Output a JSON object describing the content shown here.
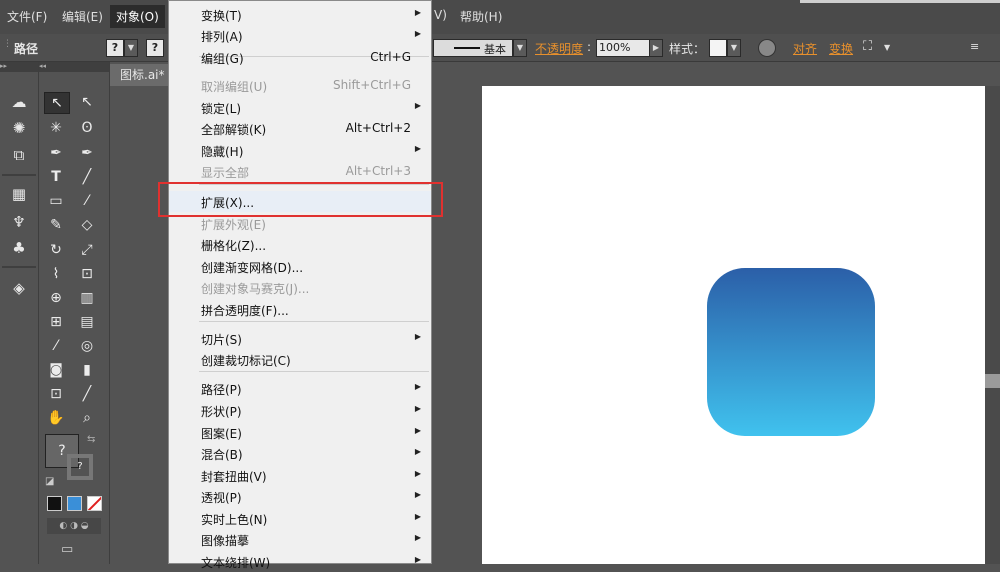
{
  "menubar": {
    "items": [
      "文件(F)",
      "编辑(E)",
      "对象(O)",
      "V)",
      "帮助(H)"
    ]
  },
  "controlbar": {
    "selection_label": "路径",
    "stroke_style": "基本",
    "opacity_label": "不透明度",
    "opacity_value": "100%",
    "style_label": "样式：",
    "align_label": "对齐",
    "transform_label": "变换",
    "unknown_glyph": "?"
  },
  "document": {
    "tab_title": "图标.ai*"
  },
  "tools": {
    "swatch_unknown": "?"
  },
  "object_menu": {
    "items": [
      {
        "label": "变换(T)",
        "shortcut": "",
        "submenu": true,
        "disabled": false
      },
      {
        "label": "排列(A)",
        "shortcut": "",
        "submenu": true,
        "disabled": false
      },
      {
        "label": "编组(G)",
        "shortcut": "Ctrl+G",
        "submenu": false,
        "disabled": false
      },
      {
        "label": "取消编组(U)",
        "shortcut": "Shift+Ctrl+G",
        "submenu": false,
        "disabled": true
      },
      {
        "label": "锁定(L)",
        "shortcut": "",
        "submenu": true,
        "disabled": false
      },
      {
        "label": "全部解锁(K)",
        "shortcut": "Alt+Ctrl+2",
        "submenu": false,
        "disabled": false
      },
      {
        "label": "隐藏(H)",
        "shortcut": "",
        "submenu": true,
        "disabled": false
      },
      {
        "label": "显示全部",
        "shortcut": "Alt+Ctrl+3",
        "submenu": false,
        "disabled": true
      },
      {
        "label": "扩展(X)...",
        "shortcut": "",
        "submenu": false,
        "disabled": false,
        "highlighted": true
      },
      {
        "label": "扩展外观(E)",
        "shortcut": "",
        "submenu": false,
        "disabled": true
      },
      {
        "label": "栅格化(Z)...",
        "shortcut": "",
        "submenu": false,
        "disabled": false
      },
      {
        "label": "创建渐变网格(D)...",
        "shortcut": "",
        "submenu": false,
        "disabled": false
      },
      {
        "label": "创建对象马赛克(J)...",
        "shortcut": "",
        "submenu": false,
        "disabled": true
      },
      {
        "label": "拼合透明度(F)...",
        "shortcut": "",
        "submenu": false,
        "disabled": false
      },
      {
        "label": "切片(S)",
        "shortcut": "",
        "submenu": true,
        "disabled": false
      },
      {
        "label": "创建裁切标记(C)",
        "shortcut": "",
        "submenu": false,
        "disabled": false
      },
      {
        "label": "路径(P)",
        "shortcut": "",
        "submenu": true,
        "disabled": false
      },
      {
        "label": "形状(P)",
        "shortcut": "",
        "submenu": true,
        "disabled": false
      },
      {
        "label": "图案(E)",
        "shortcut": "",
        "submenu": true,
        "disabled": false
      },
      {
        "label": "混合(B)",
        "shortcut": "",
        "submenu": true,
        "disabled": false
      },
      {
        "label": "封套扭曲(V)",
        "shortcut": "",
        "submenu": true,
        "disabled": false
      },
      {
        "label": "透视(P)",
        "shortcut": "",
        "submenu": true,
        "disabled": false
      },
      {
        "label": "实时上色(N)",
        "shortcut": "",
        "submenu": true,
        "disabled": false
      },
      {
        "label": "图像描摹",
        "shortcut": "",
        "submenu": true,
        "disabled": false
      },
      {
        "label": "文本绕排(W)",
        "shortcut": "",
        "submenu": true,
        "disabled": false
      }
    ]
  },
  "colors": {
    "accent_orange": "#e8902c",
    "highlight_border": "#e0312f",
    "gradient_top": "#2b5fa8",
    "gradient_bottom": "#40c2ee"
  }
}
